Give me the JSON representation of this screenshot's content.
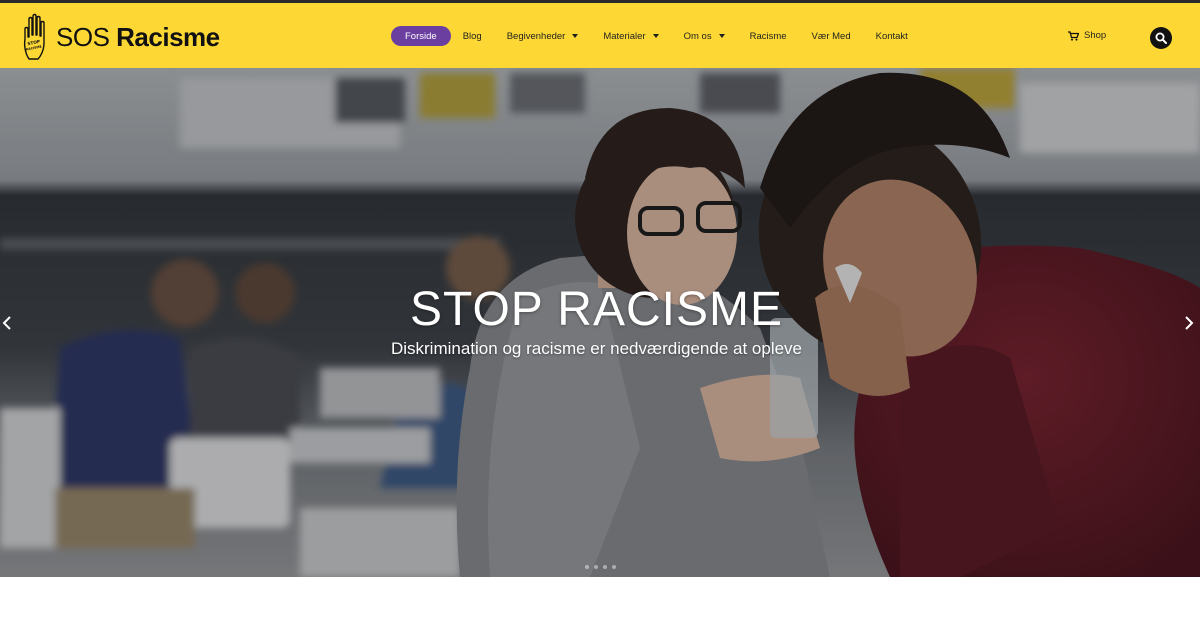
{
  "logo": {
    "text_sos": "SOS",
    "text_racisme": "Racisme",
    "hand_text": "STOP RACISME"
  },
  "nav": {
    "items": [
      {
        "label": "Forside",
        "active": true,
        "dropdown": false
      },
      {
        "label": "Blog",
        "active": false,
        "dropdown": false
      },
      {
        "label": "Begivenheder",
        "active": false,
        "dropdown": true
      },
      {
        "label": "Materialer",
        "active": false,
        "dropdown": true
      },
      {
        "label": "Om os",
        "active": false,
        "dropdown": true
      },
      {
        "label": "Racisme",
        "active": false,
        "dropdown": false
      },
      {
        "label": "Vær Med",
        "active": false,
        "dropdown": false
      },
      {
        "label": "Kontakt",
        "active": false,
        "dropdown": false
      }
    ]
  },
  "shop": {
    "label": "Shop",
    "icon": "cart-icon"
  },
  "search": {
    "icon": "search-icon"
  },
  "hero": {
    "title": "STOP RACISME",
    "subtitle": "Diskrimination og racisme er nedværdigende at opleve",
    "slide_count": 4
  },
  "colors": {
    "header_bg": "#fdd835",
    "active_nav_bg": "#6b3fa0",
    "text_dark": "#111111"
  }
}
